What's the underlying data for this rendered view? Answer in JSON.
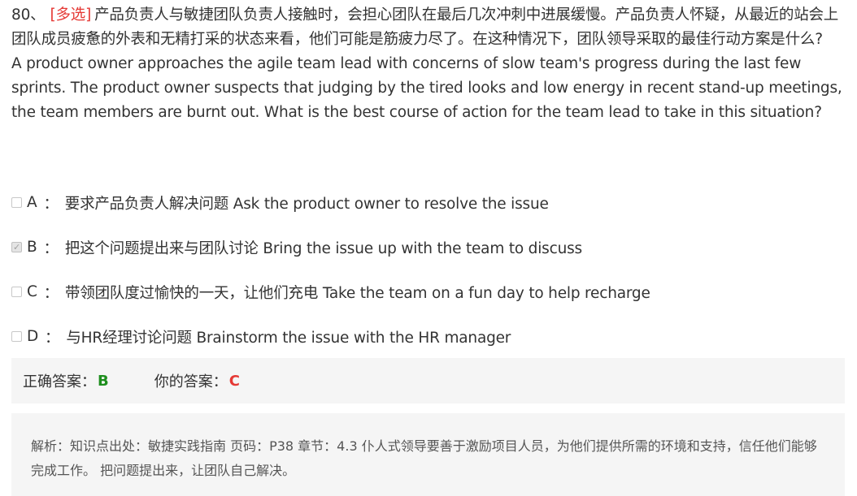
{
  "question": {
    "number": "80、",
    "tag": "[多选]",
    "text_cn": "产品负责人与敏捷团队负责人接触时，会担心团队在最后几次冲刺中进展缓慢。产品负责人怀疑，从最近的站会上团队成员疲惫的外表和无精打采的状态来看，他们可能是筋疲力尽了。在这种情况下，团队领导采取的最佳行动方案是什么?",
    "text_en": "A product owner approaches the agile team lead with concerns of slow team's progress during the last few sprints. The product owner suspects that judging by the tired looks and low energy in recent stand-up meetings, the team members are burnt out. What is the best course of action for the team lead to take in this situation?"
  },
  "options": [
    {
      "letter": "A",
      "sep": "：",
      "text": "要求产品负责人解决问题 Ask the product owner to resolve the issue",
      "checked": false
    },
    {
      "letter": "B",
      "sep": "：",
      "text": " 把这个问题提出来与团队讨论 Bring the issue up with the team to discuss",
      "checked": true
    },
    {
      "letter": "C",
      "sep": "：",
      "text": "带领团队度过愉快的一天，让他们充电 Take the team on a fun day to help recharge",
      "checked": false
    },
    {
      "letter": "D",
      "sep": "：",
      "text": "与HR经理讨论问题 Brainstorm the issue with the HR manager",
      "checked": false
    }
  ],
  "answer": {
    "correct_label": "正确答案：",
    "correct_value": "B",
    "yours_label": "你的答案：",
    "yours_value": "C"
  },
  "analysis": {
    "text": "解析：知识点出处：敏捷实践指南 页码：P38 章节：4.3 仆人式领导要善于激励项目人员，为他们提供所需的环境和支持，信任他们能够完成工作。 把问题提出来，让团队自己解决。"
  },
  "colors": {
    "tag": "#e53935",
    "correct": "#1e8e1e",
    "wrong": "#e53935",
    "panel_bg": "#f5f5f5"
  },
  "icons": {
    "checked": "checkmark-icon"
  }
}
